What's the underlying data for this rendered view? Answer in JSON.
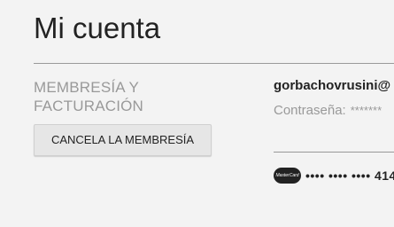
{
  "page": {
    "title": "Mi cuenta"
  },
  "membership": {
    "heading": "MEMBRESÍA Y FACTURACIÓN",
    "cancel_label": "CANCELA LA MEMBRESÍA"
  },
  "account": {
    "email": "gorbachovrusini@",
    "password_label": "Contraseña:",
    "password_mask": "*******"
  },
  "payment": {
    "card_brand": "MasterCard",
    "card_icon": "mastercard-icon",
    "card_number": "•••• •••• •••• 414"
  }
}
